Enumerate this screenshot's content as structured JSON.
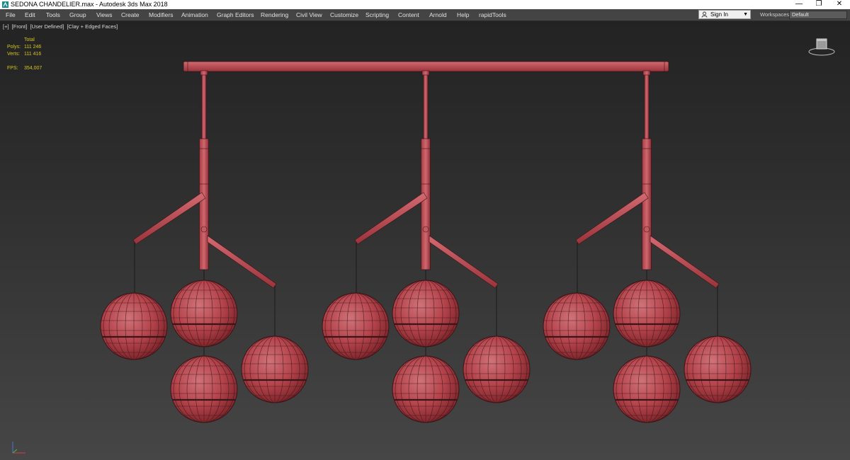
{
  "window": {
    "title": "SEDONA CHANDELIER.max - Autodesk 3ds Max 2018",
    "minimize_glyph": "—",
    "maximize_glyph": "❐",
    "close_glyph": "✕"
  },
  "menu": {
    "items": [
      "File",
      "Edit",
      "Tools",
      "Group",
      "Views",
      "Create",
      "Modifiers",
      "Animation",
      "Graph Editors",
      "Rendering",
      "Civil View",
      "Customize",
      "Scripting",
      "Content",
      "Arnold",
      "Help",
      "rapidTools"
    ],
    "sign_in": "Sign In",
    "workspaces_label": "Workspaces:",
    "workspaces_value": "Default"
  },
  "viewport": {
    "labels": [
      "[+]",
      "[Front]",
      "[User Defined]",
      "[Clay + Edged Faces]"
    ],
    "stats": {
      "header": "Total",
      "polys_label": "Polys:",
      "polys_value": "111 246",
      "verts_label": "Verts:",
      "verts_value": "111 416",
      "fps_label": "FPS:",
      "fps_value": "354,007"
    }
  },
  "colors": {
    "model_fill": "#b8474e",
    "model_edge": "#3a1518",
    "stats_text": "#d6c61a"
  },
  "icons": {
    "app": "3ds-max-logo-icon",
    "signin": "user-icon",
    "viewcube": "viewcube-icon",
    "axis": "axis-tripod-icon"
  }
}
